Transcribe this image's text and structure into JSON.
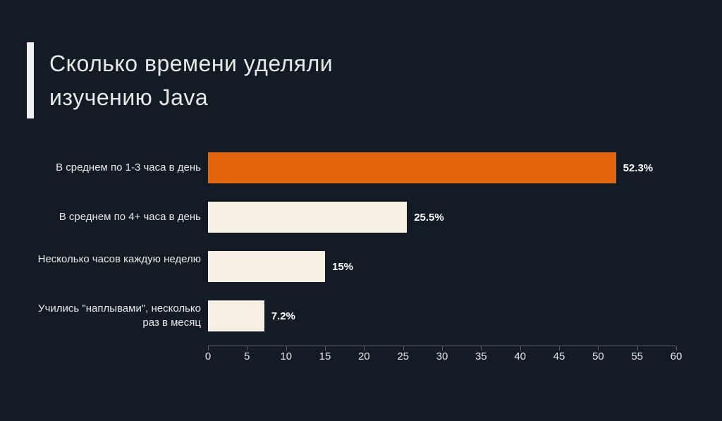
{
  "title": "Сколько времени уделяли изучению Java",
  "chart_data": {
    "type": "bar",
    "orientation": "horizontal",
    "categories": [
      "В среднем по 1-3 часа в день",
      "В среднем по 4+ часа в день",
      "Несколько часов каждую неделю",
      "Учились \"наплывами\", несколько раз в месяц"
    ],
    "values": [
      52.3,
      25.5,
      15,
      7.2
    ],
    "value_labels": [
      "52.3%",
      "25.5%",
      "15%",
      "7.2%"
    ],
    "colors": [
      "#e6650a",
      "#f5f0e1",
      "#f5f0e1",
      "#f5f0e1"
    ],
    "title": "Сколько времени уделяли изучению Java",
    "xlabel": "",
    "ylabel": "",
    "xlim": [
      0,
      60
    ],
    "x_ticks": [
      0,
      5,
      10,
      15,
      20,
      25,
      30,
      35,
      40,
      45,
      50,
      55,
      60
    ]
  }
}
